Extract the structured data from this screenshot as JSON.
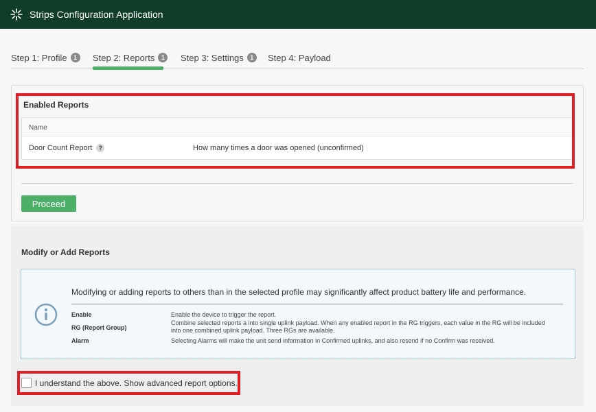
{
  "app": {
    "title": "Strips Configuration Application"
  },
  "tabs": [
    {
      "label": "Step 1: Profile",
      "badge": "1"
    },
    {
      "label": "Step 2: Reports",
      "badge": "1"
    },
    {
      "label": "Step 3: Settings",
      "badge": "1"
    },
    {
      "label": "Step 4: Payload",
      "badge": ""
    }
  ],
  "active_tab": "Step 2: Reports",
  "enabled_reports": {
    "title": "Enabled Reports",
    "column_name": "Name",
    "rows": [
      {
        "name": "Door Count Report",
        "help": "?",
        "description": "How many times a door was opened (unconfirmed)"
      }
    ]
  },
  "proceed_label": "Proceed",
  "modify": {
    "title": "Modify or Add Reports",
    "warning": "Modifying or adding reports to others than in the selected profile may significantly affect product battery life and performance.",
    "definitions": [
      {
        "term": "Enable",
        "desc": "Enable the device to trigger the report."
      },
      {
        "term": "RG (Report Group)",
        "desc": "Combine selected reports a into single uplink payload. When any enabled report in the RG triggers, each value in the RG will be included into one combined uplink payload. Three RGs are available."
      },
      {
        "term": "Alarm",
        "desc": "Selecting Alarms will make the unit send information in Confirmed uplinks, and also resend if no Confirm was received."
      }
    ],
    "checkbox_label": "I understand the above. Show advanced report options.",
    "checkbox_checked": false
  },
  "colors": {
    "header_bg": "#0f3d27",
    "accent_green": "#4caf68",
    "highlight_red": "#e01e26",
    "info_border": "#9ec1dc"
  }
}
